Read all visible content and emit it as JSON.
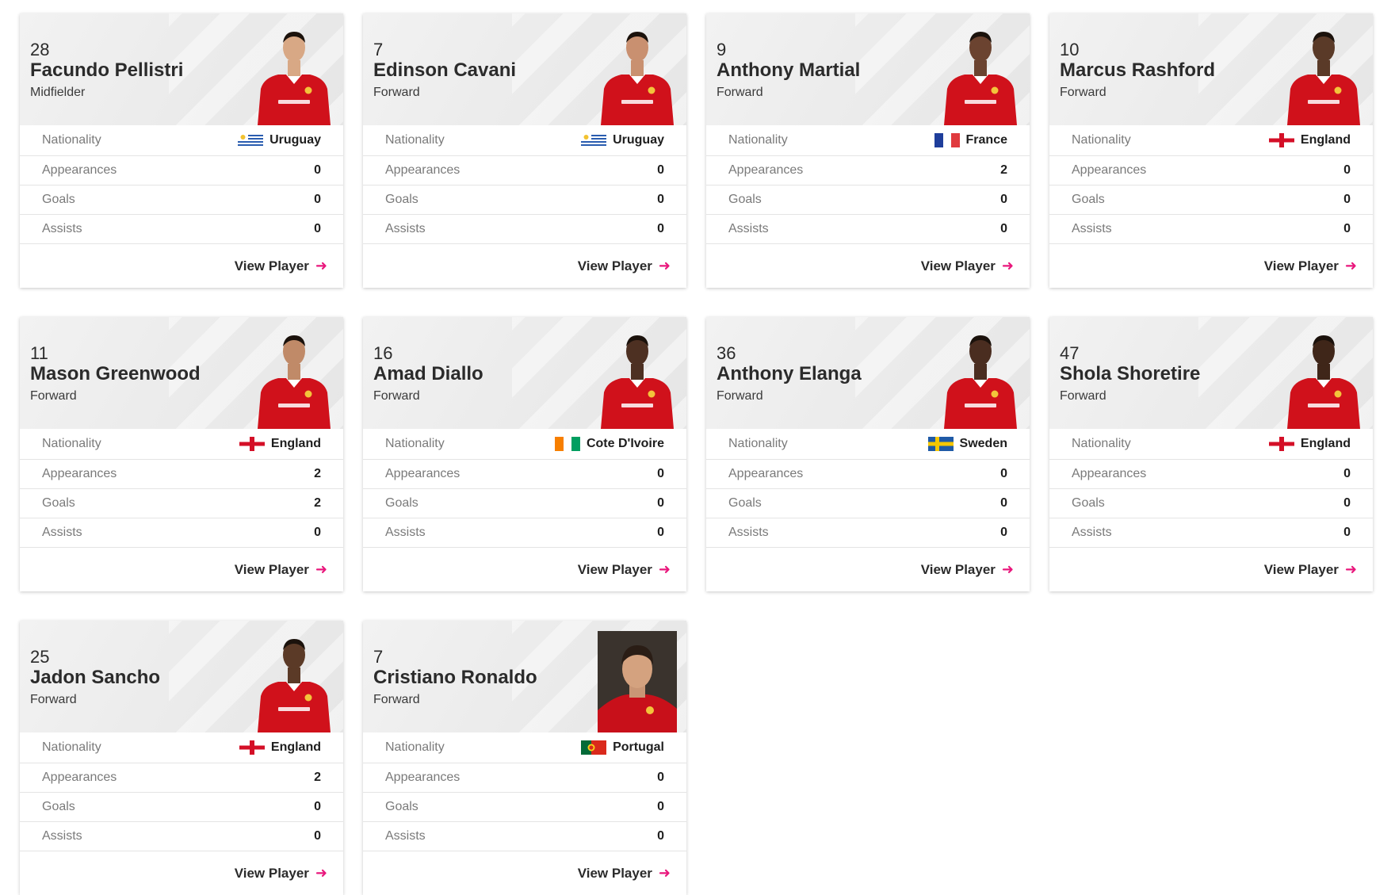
{
  "labels": {
    "nationality": "Nationality",
    "appearances": "Appearances",
    "goals": "Goals",
    "assists": "Assists",
    "view_player": "View Player"
  },
  "players": [
    {
      "number": "28",
      "name": "Facundo Pellistri",
      "position": "Midfielder",
      "nationality": "Uruguay",
      "flag": "uruguay-flag",
      "appearances": "0",
      "goals": "0",
      "assists": "0"
    },
    {
      "number": "7",
      "name": "Edinson Cavani",
      "position": "Forward",
      "nationality": "Uruguay",
      "flag": "uruguay-flag",
      "appearances": "0",
      "goals": "0",
      "assists": "0"
    },
    {
      "number": "9",
      "name": "Anthony Martial",
      "position": "Forward",
      "nationality": "France",
      "flag": "france-flag",
      "appearances": "2",
      "goals": "0",
      "assists": "0"
    },
    {
      "number": "10",
      "name": "Marcus Rashford",
      "position": "Forward",
      "nationality": "England",
      "flag": "england-flag",
      "appearances": "0",
      "goals": "0",
      "assists": "0"
    },
    {
      "number": "11",
      "name": "Mason Greenwood",
      "position": "Forward",
      "nationality": "England",
      "flag": "england-flag",
      "appearances": "2",
      "goals": "2",
      "assists": "0"
    },
    {
      "number": "16",
      "name": "Amad Diallo",
      "position": "Forward",
      "nationality": "Cote D'Ivoire",
      "flag": "cote-divoire-flag",
      "appearances": "0",
      "goals": "0",
      "assists": "0"
    },
    {
      "number": "36",
      "name": "Anthony Elanga",
      "position": "Forward",
      "nationality": "Sweden",
      "flag": "sweden-flag",
      "appearances": "0",
      "goals": "0",
      "assists": "0"
    },
    {
      "number": "47",
      "name": "Shola Shoretire",
      "position": "Forward",
      "nationality": "England",
      "flag": "england-flag",
      "appearances": "0",
      "goals": "0",
      "assists": "0"
    },
    {
      "number": "25",
      "name": "Jadon Sancho",
      "position": "Forward",
      "nationality": "England",
      "flag": "england-flag",
      "appearances": "2",
      "goals": "0",
      "assists": "0"
    },
    {
      "number": "7",
      "name": "Cristiano Ronaldo",
      "position": "Forward",
      "nationality": "Portugal",
      "flag": "portugal-flag",
      "appearances": "0",
      "goals": "0",
      "assists": "0"
    }
  ],
  "colors": {
    "kit_red": "#d0111b",
    "accent_pink": "#e9177c",
    "text_dark": "#2b2b2b"
  }
}
